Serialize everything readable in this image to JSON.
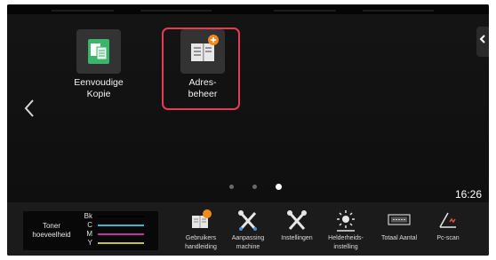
{
  "apps": [
    {
      "label": "Eenvoudige\nKopie",
      "icon": "copy-icon"
    },
    {
      "label": "Adres-\nbeheer",
      "icon": "address-book-icon"
    }
  ],
  "time": "16:26",
  "pager": {
    "page_count": 3,
    "current_page": 3
  },
  "toner": {
    "label": "Toner\nhoeveelheid",
    "colors": [
      {
        "letter": "Bk",
        "color": "#000000"
      },
      {
        "letter": "C",
        "color": "#3fb6c8"
      },
      {
        "letter": "M",
        "color": "#c0349c"
      },
      {
        "letter": "Y",
        "color": "#c9c23a"
      }
    ]
  },
  "toolbar": [
    {
      "label": "Gebruikers\nhandleiding",
      "icon": "manual-icon"
    },
    {
      "label": "Aanpassing\nmachine",
      "icon": "machine-adjust-icon"
    },
    {
      "label": "Instellingen",
      "icon": "settings-tools-icon"
    },
    {
      "label": "Helderheids-\ninstelling",
      "icon": "brightness-icon"
    },
    {
      "label": "Totaal Aantal",
      "icon": "total-count-icon"
    },
    {
      "label": "Pc-scan",
      "icon": "pc-scan-icon"
    }
  ],
  "colors": {
    "selection": "#e53c52",
    "copy_icon": "#3ab56a",
    "badge": "#f08a1c"
  }
}
